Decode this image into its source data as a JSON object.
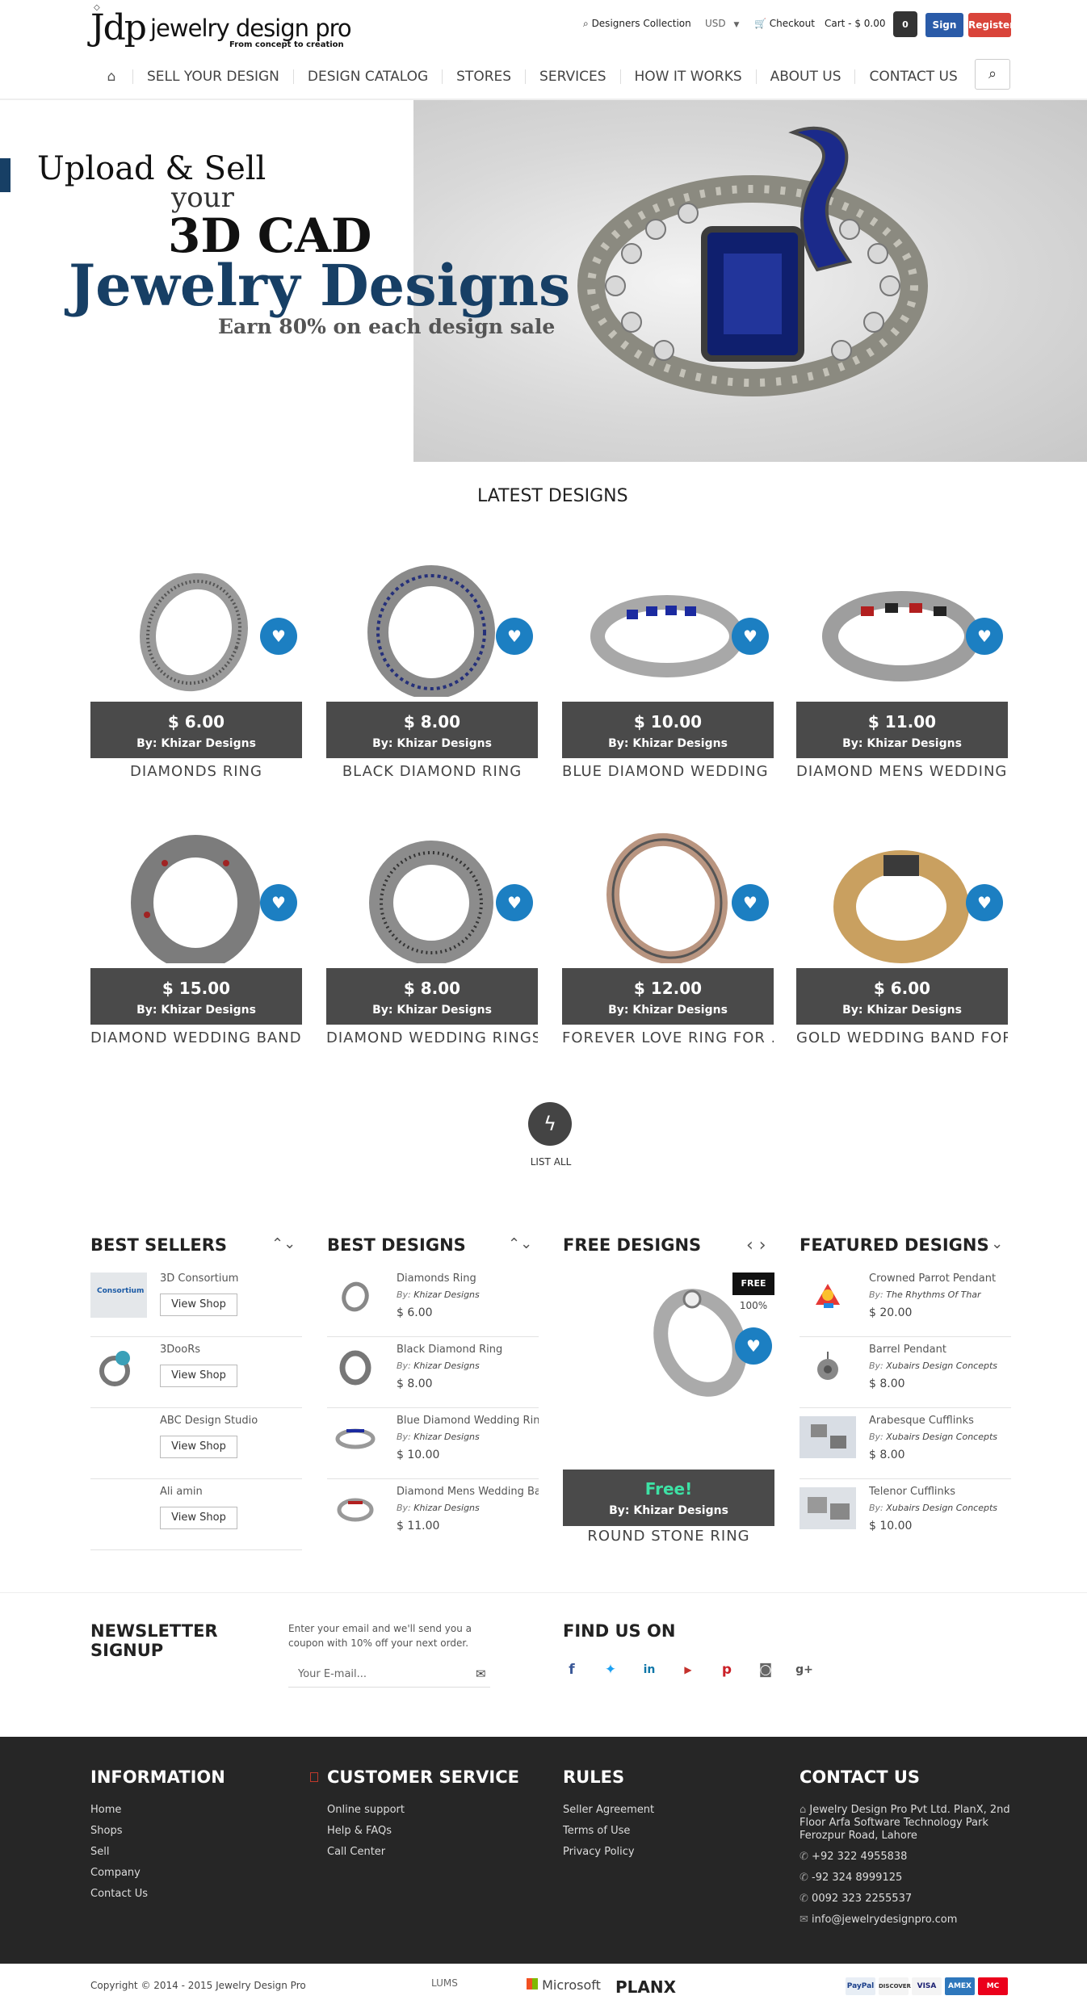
{
  "header": {
    "logo_mark": "Jdp",
    "logo_name": "jewelry design pro",
    "tagline": "From concept to creation",
    "designers_collection": "Designers Collection",
    "currency": "USD",
    "checkout": "Checkout",
    "cart": "Cart - $ 0.00",
    "cart_count": "0",
    "sign_in": "Sign In",
    "register": "Register"
  },
  "nav": [
    "Sell Your Design",
    "Design Catalog",
    "Stores",
    "Services",
    "How It Works",
    "About Us",
    "Contact Us"
  ],
  "hero": {
    "line1": "Upload & Sell",
    "line2": "your",
    "line3": "3D CAD",
    "line4": "Jewelry Designs",
    "line5": "Earn 80% on each design sale"
  },
  "latest": {
    "title": "Latest Designs",
    "items": [
      {
        "price": "$ 6.00",
        "by": "By: Khizar Designs",
        "name": "Diamonds Ring"
      },
      {
        "price": "$ 8.00",
        "by": "By: Khizar Designs",
        "name": "Black Diamond Ring"
      },
      {
        "price": "$ 10.00",
        "by": "By: Khizar Designs",
        "name": "Blue Diamond Wedding ..."
      },
      {
        "price": "$ 11.00",
        "by": "By: Khizar Designs",
        "name": "Diamond Mens Wedding ..."
      },
      {
        "price": "$ 15.00",
        "by": "By: Khizar Designs",
        "name": "Diamond Wedding Band..."
      },
      {
        "price": "$ 8.00",
        "by": "By: Khizar Designs",
        "name": "Diamond Wedding Rings..."
      },
      {
        "price": "$ 12.00",
        "by": "By: Khizar Designs",
        "name": "Forever Love Ring For ..."
      },
      {
        "price": "$ 6.00",
        "by": "By: Khizar Designs",
        "name": "Gold Wedding Band For..."
      }
    ],
    "list_all": "List All"
  },
  "best_sellers": {
    "title": "Best Sellers",
    "items": [
      {
        "name": "3D Consortium",
        "button": "View Shop"
      },
      {
        "name": "3DooRs",
        "button": "View Shop"
      },
      {
        "name": "ABC Design Studio",
        "button": "View Shop"
      },
      {
        "name": "Ali amin",
        "button": "View Shop"
      }
    ]
  },
  "best_designs": {
    "title": "Best Designs",
    "by_prefix": "By:",
    "items": [
      {
        "name": "Diamonds Ring",
        "by": "Khizar Designs",
        "price": "$ 6.00"
      },
      {
        "name": "Black Diamond Ring",
        "by": "Khizar Designs",
        "price": "$ 8.00"
      },
      {
        "name": "Blue Diamond Wedding Ring",
        "by": "Khizar Designs",
        "price": "$ 10.00"
      },
      {
        "name": "Diamond Mens Wedding Ba...",
        "by": "Khizar Designs",
        "price": "$ 11.00"
      }
    ]
  },
  "free_designs": {
    "title": "Free Designs",
    "badge": "FREE",
    "percent": "100%",
    "label": "Free!",
    "by": "By: Khizar Designs",
    "name": "Round Stone Ring"
  },
  "featured": {
    "title": "Featured Designs",
    "by_prefix": "By:",
    "items": [
      {
        "name": "Crowned Parrot Pendant",
        "by": "The Rhythms Of Thar",
        "price": "$ 20.00"
      },
      {
        "name": "Barrel Pendant",
        "by": "Xubairs Design Concepts",
        "price": "$ 8.00"
      },
      {
        "name": "Arabesque Cufflinks",
        "by": "Xubairs Design Concepts",
        "price": "$ 8.00"
      },
      {
        "name": "Telenor Cufflinks",
        "by": "Xubairs Design Concepts",
        "price": "$ 10.00"
      }
    ]
  },
  "newsletter": {
    "title": "Newsletter Signup",
    "description": "Enter your email and we'll send you a coupon with 10% off your next order.",
    "placeholder": "Your E-mail..."
  },
  "find_us": {
    "title": "Find Us On",
    "icons": [
      "f",
      "t",
      "in",
      "yt",
      "p",
      "ig",
      "g+"
    ]
  },
  "footer": {
    "information": {
      "title": "Information",
      "links": [
        "Home",
        "Shops",
        "Sell",
        "Company",
        "Contact Us"
      ]
    },
    "customer_service": {
      "title": "Customer Service",
      "links": [
        "Online support",
        "Help & FAQs",
        "Call Center"
      ]
    },
    "rules": {
      "title": "Rules",
      "links": [
        "Seller Agreement",
        "Terms of Use",
        "Privacy Policy"
      ]
    },
    "contact": {
      "title": "Contact Us",
      "address": "Jewelry Design Pro Pvt Ltd. PlanX, 2nd Floor Arfa Software Technology Park Ferozpur Road, Lahore",
      "phone1": "+92 322 4955838",
      "phone2": "-92 324 8999125",
      "phone3": "0092 323 2255537",
      "email": "info@jewelrydesignpro.com"
    },
    "copyright": "Copyright © 2014 - 2015 Jewelry Design Pro",
    "partners": [
      "LUMS",
      "Microsoft",
      "PLANX"
    ],
    "payments": [
      "PayPal",
      "DISCOVER",
      "VISA",
      "AMEX",
      "MC"
    ]
  },
  "colors": {
    "brand_navy": "#173f65",
    "heart_blue": "#1c7fc2",
    "sign_in": "#2a5ba8",
    "register": "#d9443a",
    "footer_bg": "#262626",
    "free_green": "#3de2a5"
  }
}
